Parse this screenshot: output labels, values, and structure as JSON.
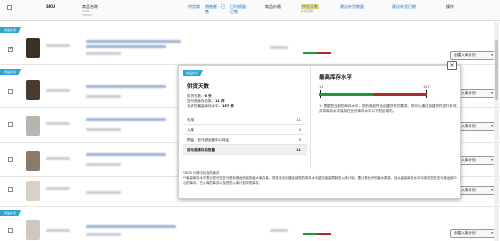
{
  "header": {
    "sku": "SKU",
    "product_name": "商品名称",
    "product_name_sub1": "ASIN",
    "product_name_sub2": "FNSKU",
    "c1": "供货商",
    "c2": "销售额 - 已售",
    "c3": "日均销量 - 已售",
    "c4": "商品价格",
    "c5": "供货天数",
    "c5_sub": "补货周期",
    "c6": "建议补货数量",
    "c7": "建议补货日期",
    "actions": "操作"
  },
  "row_tag": "商品补货",
  "row_button": "创建入库计划",
  "popup": {
    "tag": "商品补货",
    "left_title": "供货天数",
    "stats": [
      {
        "label": "供货天数：",
        "value": "6 天"
      },
      {
        "label": "亚马逊库存总数：",
        "value": "11 件"
      },
      {
        "label": "允许的最高库存水平：",
        "value": "157 件"
      }
    ],
    "table": [
      {
        "label": "可用",
        "value": "11"
      },
      {
        "label": "入库",
        "value": "0"
      },
      {
        "label": "预留 - 亚马逊运营中心转运",
        "value": "0"
      },
      {
        "label": "亚马逊库存总数量",
        "value": "11"
      }
    ],
    "right_title": "最高库存水平",
    "cap_left": "11",
    "cap_right": "157",
    "info": "根据您当前的库存水平，您的商品符合创建货件的要求。您可以通过创建货件进行补货，并将库存水平保持在允许库存水平以下的区域内。",
    "info_marker": "1",
    "notes": [
      "*DOS 计算中包含的库存",
      "**最高库存水平表示您可在亚马逊存储此商品的最大库存量。您将无法创建会使您的库存水平超过最高限制的入库计划。要计算允许的最大数量，请从最高库存水平中减去您在亚马逊运营中心的库存、已入库的库存以及您的入库计划中的库存。"
    ],
    "close": "×"
  },
  "colors": {
    "accent": "#2da5d2",
    "link": "#1a6ec2",
    "highlight": "#f7e37a",
    "green": "#1f9a3a",
    "red": "#b02a2a"
  }
}
